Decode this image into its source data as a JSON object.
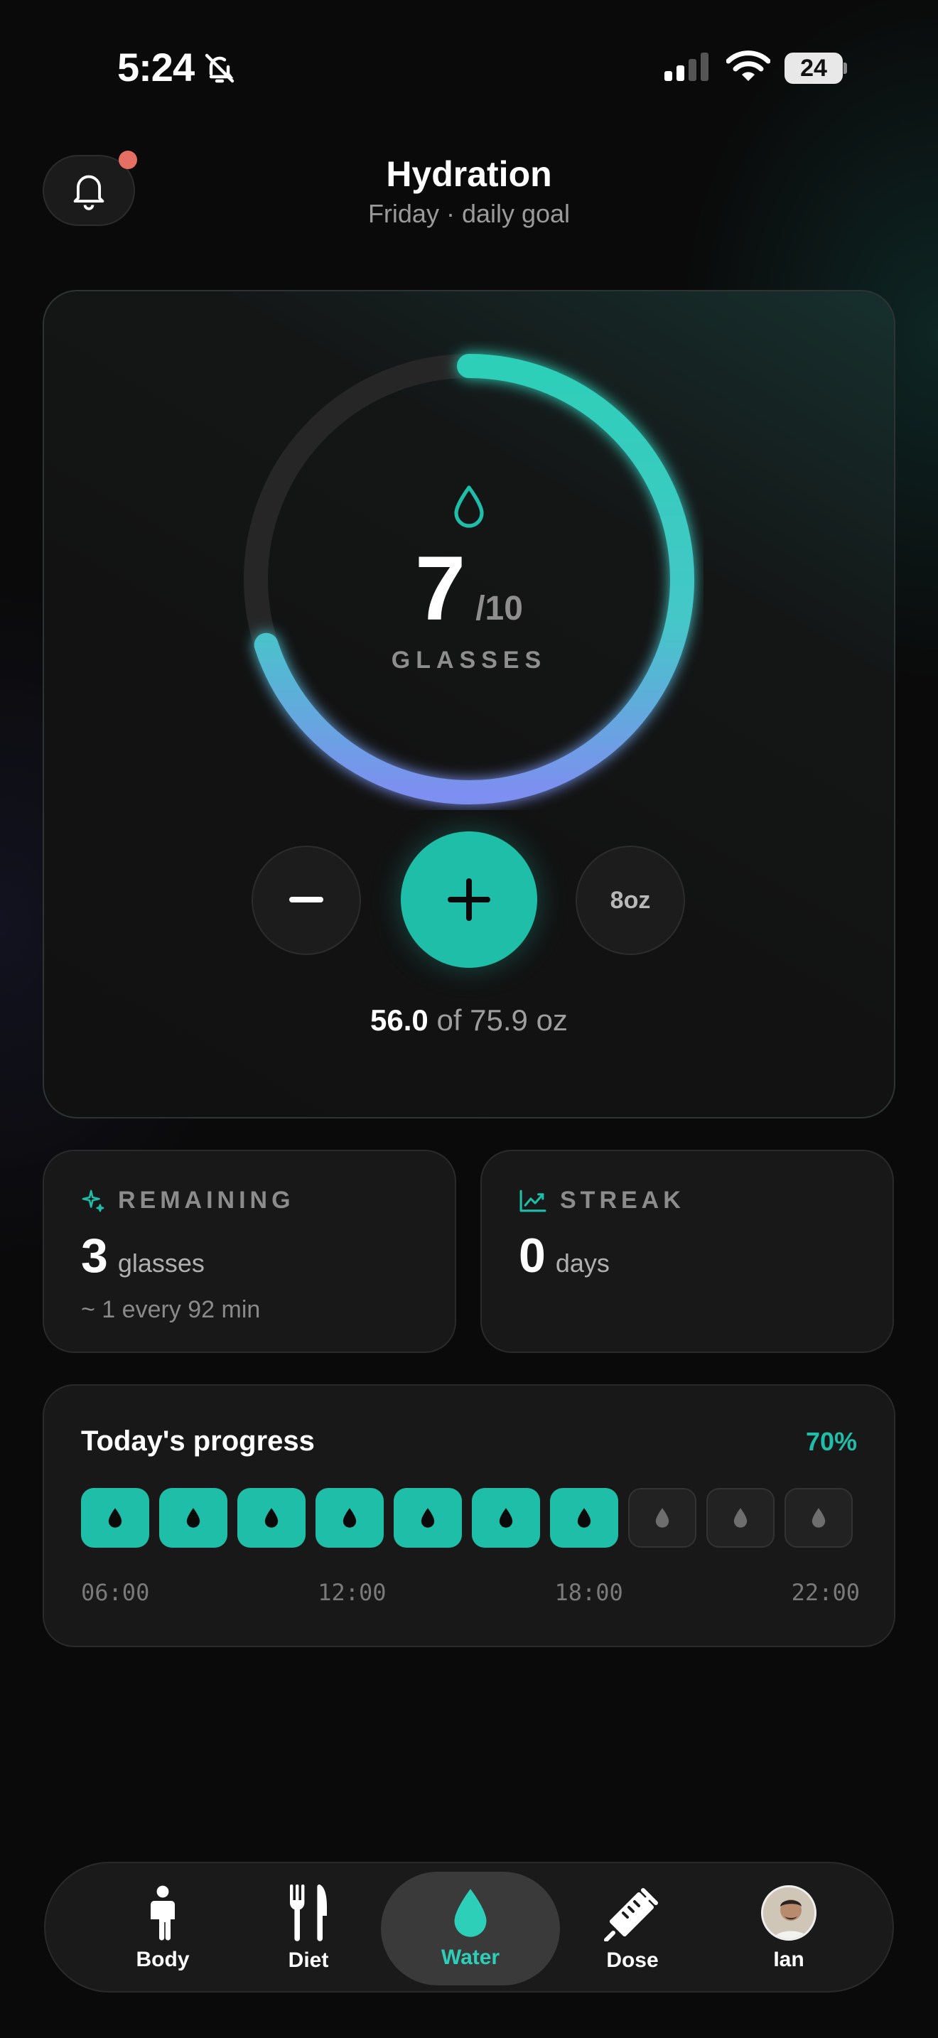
{
  "status_bar": {
    "time": "5:24",
    "battery": "24"
  },
  "header": {
    "title": "Hydration",
    "subtitle": "Friday · daily goal"
  },
  "intake": {
    "count": "7",
    "goal": "/10",
    "unit_label": "GLASSES",
    "progress_fraction": 0.7,
    "serving_size": "8oz",
    "oz_consumed": "56.0",
    "oz_of": "of 75.9 oz"
  },
  "remaining": {
    "label": "REMAINING",
    "value": "3",
    "unit": "glasses",
    "note": "~ 1 every 92 min"
  },
  "streak": {
    "label": "STREAK",
    "value": "0",
    "unit": "days"
  },
  "progress": {
    "title": "Today's progress",
    "percent": "70%",
    "filled": 7,
    "total": 10,
    "times": [
      "06:00",
      "12:00",
      "18:00",
      "22:00"
    ]
  },
  "tabs": [
    {
      "label": "Body",
      "icon": "person-icon"
    },
    {
      "label": "Diet",
      "icon": "fork-knife-icon"
    },
    {
      "label": "Water",
      "icon": "water-drop-icon",
      "active": true
    },
    {
      "label": "Dose",
      "icon": "syringe-icon"
    },
    {
      "label": "Ian",
      "icon": "avatar"
    }
  ],
  "colors": {
    "accent": "#1fbea9",
    "ring_start": "#2dcfb8",
    "ring_end": "#7d8ff0",
    "notification": "#e46f62"
  }
}
